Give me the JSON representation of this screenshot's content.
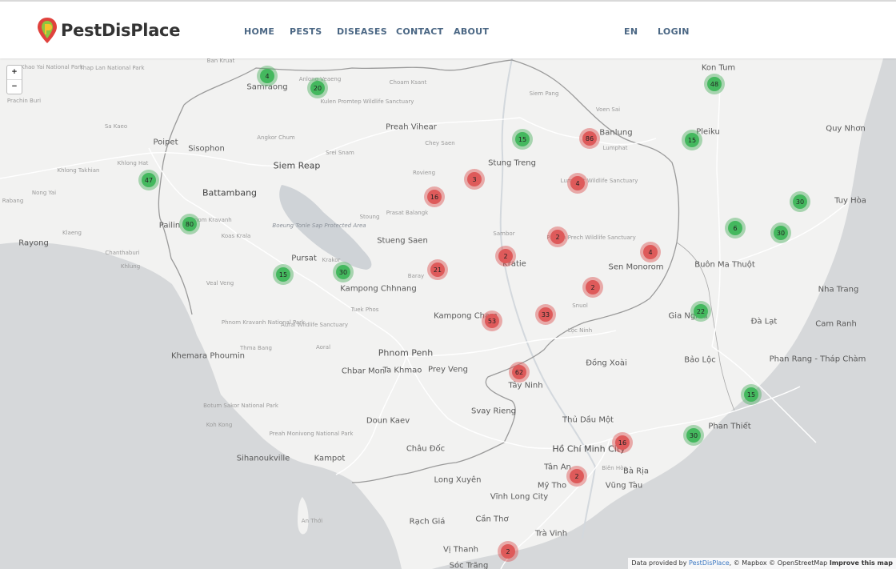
{
  "header": {
    "brand": "PestDisPlace",
    "nav": [
      "HOME",
      "PESTS",
      "DISEASES",
      "CONTACT",
      "ABOUT"
    ],
    "lang": "EN",
    "login": "LOGIN"
  },
  "colors": {
    "pest_cluster": "#44b85e",
    "disease_cluster": "#de5a5a",
    "nav_text": "#4b6784"
  },
  "map": {
    "zoom_in": "+",
    "zoom_out": "−",
    "attribution": {
      "prefix": "Data provided by",
      "link": "PestDisPlace",
      "rest": ", © Mapbox © OpenStreetMap",
      "improve": "Improve this map"
    },
    "places": [
      {
        "t": "Ban Kruat",
        "c": "minor"
      },
      {
        "t": "Khao Yai National Park",
        "c": "minor"
      },
      {
        "t": "Thap Lan National Park",
        "c": "minor"
      },
      {
        "t": "Samraong",
        "c": "city"
      },
      {
        "t": "Anlong Veaeng",
        "c": "minor"
      },
      {
        "t": "Choam Ksant",
        "c": "minor"
      },
      {
        "t": "Kulen Promtep Wildlife Sanctuary",
        "c": "minor"
      },
      {
        "t": "Prachin Buri",
        "c": "minor"
      },
      {
        "t": "Sa Kaeo",
        "c": "minor"
      },
      {
        "t": "Poipet",
        "c": "city"
      },
      {
        "t": "Sisophon",
        "c": "city"
      },
      {
        "t": "Angkor Chum",
        "c": "minor"
      },
      {
        "t": "Preah Vihear",
        "c": "city"
      },
      {
        "t": "Chey Saen",
        "c": "minor"
      },
      {
        "t": "Siem Reap",
        "c": "major"
      },
      {
        "t": "Srei Snam",
        "c": "minor"
      },
      {
        "t": "Battambang",
        "c": "major"
      },
      {
        "t": "Khlong Hat",
        "c": "minor"
      },
      {
        "t": "Khlong Takhian",
        "c": "minor"
      },
      {
        "t": "Nong Yai",
        "c": "minor"
      },
      {
        "t": "Rabang",
        "c": "minor"
      },
      {
        "t": "Pailin",
        "c": "city"
      },
      {
        "t": "Phnom Kravanh",
        "c": "minor"
      },
      {
        "t": "Koas Krala",
        "c": "minor"
      },
      {
        "t": "Rovieng",
        "c": "minor"
      },
      {
        "t": "Prasat Balangk",
        "c": "minor"
      },
      {
        "t": "Stoung",
        "c": "minor"
      },
      {
        "t": "Boeung Tonle Sap Protected Area",
        "c": "water"
      },
      {
        "t": "Stueng Saen",
        "c": "city"
      },
      {
        "t": "Rayong",
        "c": "city"
      },
      {
        "t": "Klaeng",
        "c": "minor"
      },
      {
        "t": "Chanthaburi",
        "c": "minor"
      },
      {
        "t": "Khlung",
        "c": "minor"
      },
      {
        "t": "Pursat",
        "c": "city"
      },
      {
        "t": "Krakor",
        "c": "minor"
      },
      {
        "t": "Veal Veng",
        "c": "minor"
      },
      {
        "t": "Kampong Chhnang",
        "c": "city"
      },
      {
        "t": "Tuek Phos",
        "c": "minor"
      },
      {
        "t": "Phnom Kravanh National Park",
        "c": "minor"
      },
      {
        "t": "Aural Wildlife Sanctuary",
        "c": "minor"
      },
      {
        "t": "Aoral",
        "c": "minor"
      },
      {
        "t": "Thma Bang",
        "c": "minor"
      },
      {
        "t": "Khemara Phoumin",
        "c": "city"
      },
      {
        "t": "Phnom Penh",
        "c": "cap"
      },
      {
        "t": "Chbar Mon",
        "c": "city"
      },
      {
        "t": "Ta Khmao",
        "c": "city"
      },
      {
        "t": "Prey Veng",
        "c": "city"
      },
      {
        "t": "Kampong Cham",
        "c": "city"
      },
      {
        "t": "Baray",
        "c": "minor"
      },
      {
        "t": "Stung Treng",
        "c": "city"
      },
      {
        "t": "Banlung",
        "c": "city"
      },
      {
        "t": "Siem Pang",
        "c": "minor"
      },
      {
        "t": "Voen Sai",
        "c": "minor"
      },
      {
        "t": "Lumphat",
        "c": "minor"
      },
      {
        "t": "Lumphat Wildlife Sanctuary",
        "c": "minor"
      },
      {
        "t": "Kon Tum",
        "c": "city"
      },
      {
        "t": "Pleiku",
        "c": "city"
      },
      {
        "t": "Kratie",
        "c": "city"
      },
      {
        "t": "Sambor",
        "c": "minor"
      },
      {
        "t": "Phnom Prech Wildlife Sanctuary",
        "c": "minor"
      },
      {
        "t": "Sen Monorom",
        "c": "city"
      },
      {
        "t": "Snuol",
        "c": "minor"
      },
      {
        "t": "Lộc Ninh",
        "c": "minor"
      },
      {
        "t": "Buôn Ma Thuột",
        "c": "city"
      },
      {
        "t": "Gia Nghĩa",
        "c": "city"
      },
      {
        "t": "Đồng Xoài",
        "c": "city"
      },
      {
        "t": "Bảo Lộc",
        "c": "city"
      },
      {
        "t": "Đà Lạt",
        "c": "city"
      },
      {
        "t": "Cam Ranh",
        "c": "city"
      },
      {
        "t": "Nha Trang",
        "c": "city"
      },
      {
        "t": "Tuy Hòa",
        "c": "city"
      },
      {
        "t": "Quy Nhơn",
        "c": "city"
      },
      {
        "t": "Phan Rang - Tháp Chàm",
        "c": "city"
      },
      {
        "t": "Tây Ninh",
        "c": "city"
      },
      {
        "t": "Svay Rieng",
        "c": "city"
      },
      {
        "t": "Thủ Dầu Một",
        "c": "city"
      },
      {
        "t": "Hồ Chí Minh City",
        "c": "major"
      },
      {
        "t": "Biên Hòa",
        "c": "minor"
      },
      {
        "t": "Phan Thiết",
        "c": "city"
      },
      {
        "t": "Bà Rịa",
        "c": "city"
      },
      {
        "t": "Vũng Tàu",
        "c": "city"
      },
      {
        "t": "Tân An",
        "c": "city"
      },
      {
        "t": "Mỹ Tho",
        "c": "city"
      },
      {
        "t": "Doun Kaev",
        "c": "city"
      },
      {
        "t": "Châu Đốc",
        "c": "city"
      },
      {
        "t": "Long Xuyên",
        "c": "city"
      },
      {
        "t": "Vĩnh Long City",
        "c": "city"
      },
      {
        "t": "Cần Thơ",
        "c": "city"
      },
      {
        "t": "Trà Vinh",
        "c": "city"
      },
      {
        "t": "Rạch Giá",
        "c": "city"
      },
      {
        "t": "Vị Thanh",
        "c": "city"
      },
      {
        "t": "Sóc Trăng",
        "c": "city"
      },
      {
        "t": "Sihanoukville",
        "c": "city"
      },
      {
        "t": "Kampot",
        "c": "city"
      },
      {
        "t": "Preah Monivong National Park",
        "c": "minor"
      },
      {
        "t": "Botum Sakor National Park",
        "c": "minor"
      },
      {
        "t": "Koh Kong",
        "c": "minor"
      },
      {
        "t": "An Thới",
        "c": "minor"
      }
    ],
    "pest_clusters": [
      4,
      20,
      47,
      80,
      15,
      30,
      15,
      15,
      48,
      30,
      6,
      30,
      22,
      15,
      30
    ],
    "disease_clusters": [
      86,
      3,
      16,
      4,
      2,
      2,
      4,
      21,
      2,
      33,
      53,
      62,
      16,
      2,
      2
    ]
  }
}
